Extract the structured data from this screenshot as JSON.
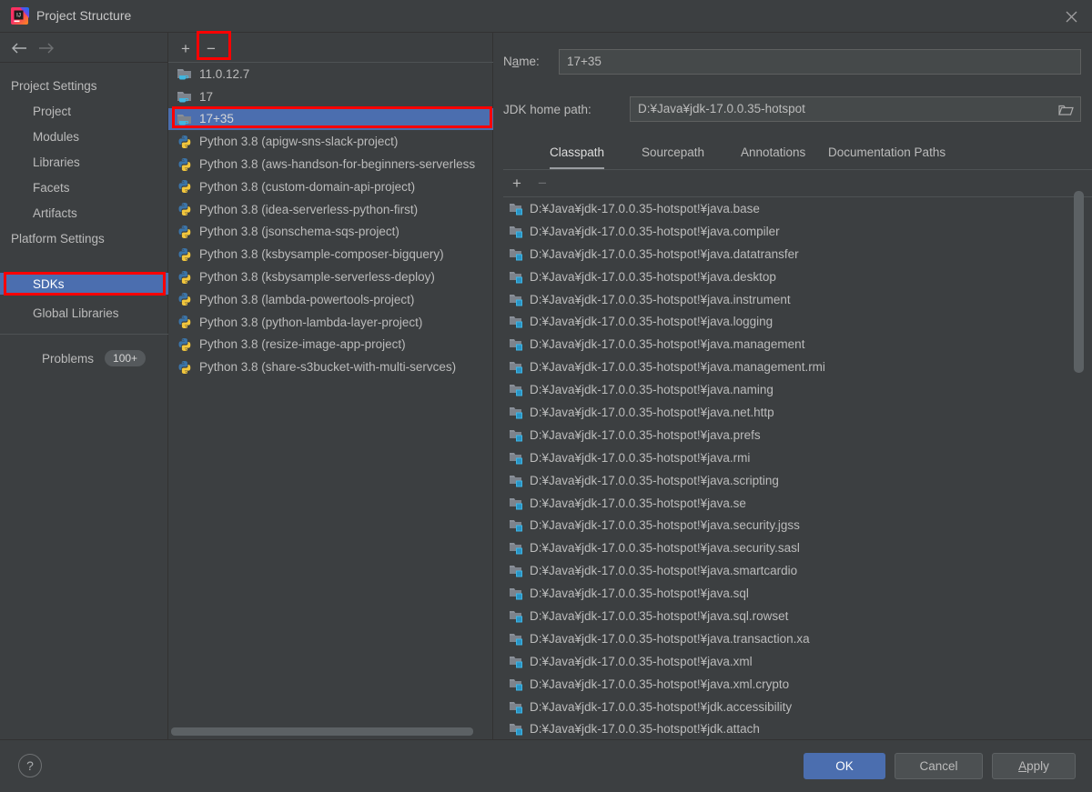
{
  "window": {
    "title": "Project Structure",
    "app_icon": "intellij-idea-logo",
    "close_icon": "close-icon"
  },
  "sidebar": {
    "back_icon": "arrow-left-icon",
    "forward_icon": "arrow-right-icon",
    "groups": [
      {
        "label": "Project Settings",
        "type": "group"
      },
      {
        "label": "Project",
        "type": "child"
      },
      {
        "label": "Modules",
        "type": "child"
      },
      {
        "label": "Libraries",
        "type": "child"
      },
      {
        "label": "Facets",
        "type": "child"
      },
      {
        "label": "Artifacts",
        "type": "child"
      },
      {
        "label": "Platform Settings",
        "type": "group"
      },
      {
        "label": "SDKs",
        "type": "child",
        "selected": true
      },
      {
        "label": "Global Libraries",
        "type": "child"
      }
    ],
    "problems": {
      "label": "Problems",
      "badge": "100+"
    }
  },
  "sdk_panel": {
    "add_label": "+",
    "remove_label": "−",
    "items": [
      {
        "label": "11.0.12.7",
        "icon": "jdk-folder-icon"
      },
      {
        "label": "17",
        "icon": "jdk-folder-icon"
      },
      {
        "label": "17+35",
        "icon": "jdk-folder-icon",
        "selected": true
      },
      {
        "label": "Python 3.8 (apigw-sns-slack-project)",
        "icon": "python-icon"
      },
      {
        "label": "Python 3.8 (aws-handson-for-beginners-serverless",
        "icon": "python-icon"
      },
      {
        "label": "Python 3.8 (custom-domain-api-project)",
        "icon": "python-icon"
      },
      {
        "label": "Python 3.8 (idea-serverless-python-first)",
        "icon": "python-icon"
      },
      {
        "label": "Python 3.8 (jsonschema-sqs-project)",
        "icon": "python-icon"
      },
      {
        "label": "Python 3.8 (ksbysample-composer-bigquery)",
        "icon": "python-icon"
      },
      {
        "label": "Python 3.8 (ksbysample-serverless-deploy)",
        "icon": "python-icon"
      },
      {
        "label": "Python 3.8 (lambda-powertools-project)",
        "icon": "python-icon"
      },
      {
        "label": "Python 3.8 (python-lambda-layer-project)",
        "icon": "python-icon"
      },
      {
        "label": "Python 3.8 (resize-image-app-project)",
        "icon": "python-icon"
      },
      {
        "label": "Python 3.8 (share-s3bucket-with-multi-servces)",
        "icon": "python-icon"
      }
    ]
  },
  "detail": {
    "name_label": "Name:",
    "name_value": "17+35",
    "jdk_home_label": "JDK home path:",
    "jdk_home_value": "D:¥Java¥jdk-17.0.0.35-hotspot",
    "browse_icon": "folder-open-icon",
    "tabs": [
      {
        "label": "Classpath",
        "active": true
      },
      {
        "label": "Sourcepath",
        "active": false
      },
      {
        "label": "Annotations",
        "active": false
      },
      {
        "label": "Documentation Paths",
        "active": false
      }
    ],
    "classpath_add_label": "+",
    "classpath_remove_label": "−",
    "classpath_entries": [
      "D:¥Java¥jdk-17.0.0.35-hotspot!¥java.base",
      "D:¥Java¥jdk-17.0.0.35-hotspot!¥java.compiler",
      "D:¥Java¥jdk-17.0.0.35-hotspot!¥java.datatransfer",
      "D:¥Java¥jdk-17.0.0.35-hotspot!¥java.desktop",
      "D:¥Java¥jdk-17.0.0.35-hotspot!¥java.instrument",
      "D:¥Java¥jdk-17.0.0.35-hotspot!¥java.logging",
      "D:¥Java¥jdk-17.0.0.35-hotspot!¥java.management",
      "D:¥Java¥jdk-17.0.0.35-hotspot!¥java.management.rmi",
      "D:¥Java¥jdk-17.0.0.35-hotspot!¥java.naming",
      "D:¥Java¥jdk-17.0.0.35-hotspot!¥java.net.http",
      "D:¥Java¥jdk-17.0.0.35-hotspot!¥java.prefs",
      "D:¥Java¥jdk-17.0.0.35-hotspot!¥java.rmi",
      "D:¥Java¥jdk-17.0.0.35-hotspot!¥java.scripting",
      "D:¥Java¥jdk-17.0.0.35-hotspot!¥java.se",
      "D:¥Java¥jdk-17.0.0.35-hotspot!¥java.security.jgss",
      "D:¥Java¥jdk-17.0.0.35-hotspot!¥java.security.sasl",
      "D:¥Java¥jdk-17.0.0.35-hotspot!¥java.smartcardio",
      "D:¥Java¥jdk-17.0.0.35-hotspot!¥java.sql",
      "D:¥Java¥jdk-17.0.0.35-hotspot!¥java.sql.rowset",
      "D:¥Java¥jdk-17.0.0.35-hotspot!¥java.transaction.xa",
      "D:¥Java¥jdk-17.0.0.35-hotspot!¥java.xml",
      "D:¥Java¥jdk-17.0.0.35-hotspot!¥java.xml.crypto",
      "D:¥Java¥jdk-17.0.0.35-hotspot!¥jdk.accessibility",
      "D:¥Java¥jdk-17.0.0.35-hotspot!¥jdk.attach"
    ]
  },
  "footer": {
    "help_label": "?",
    "ok_label": "OK",
    "cancel_label": "Cancel",
    "apply_label": "Apply"
  },
  "colors": {
    "background": "#3c3f41",
    "selection": "#4b6eaf",
    "highlight_box": "#ff0000",
    "text": "#bbbbbb",
    "field_background": "#45494a"
  }
}
